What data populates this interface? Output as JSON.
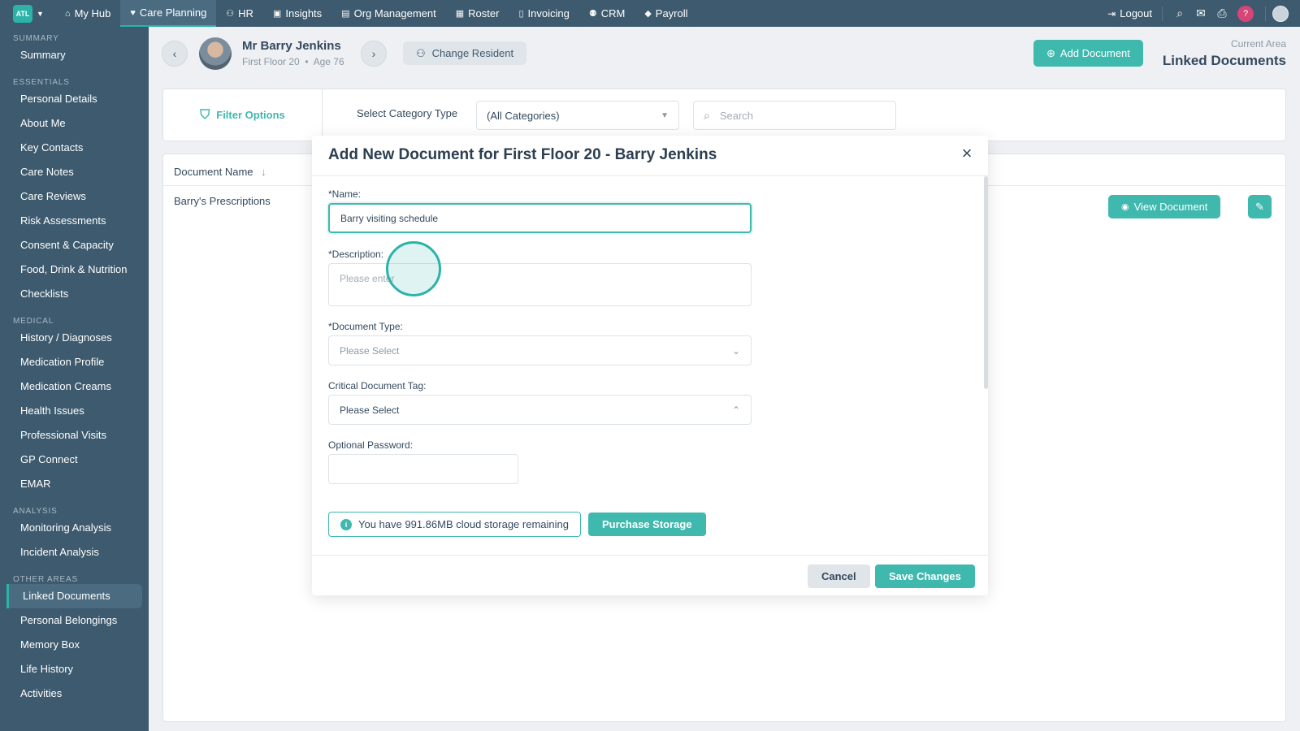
{
  "brand": {
    "logo_text": "ATL",
    "logo_color": "#2bb3a8"
  },
  "topnav": {
    "items": [
      {
        "label": "My Hub",
        "icon": "home-icon"
      },
      {
        "label": "Care Planning",
        "icon": "heart-icon"
      },
      {
        "label": "HR",
        "icon": "people-icon"
      },
      {
        "label": "Insights",
        "icon": "chart-icon"
      },
      {
        "label": "Org Management",
        "icon": "building-icon"
      },
      {
        "label": "Roster",
        "icon": "calendar-icon"
      },
      {
        "label": "Invoicing",
        "icon": "invoice-icon"
      },
      {
        "label": "CRM",
        "icon": "contacts-icon"
      },
      {
        "label": "Payroll",
        "icon": "payroll-icon"
      }
    ],
    "active": "Care Planning",
    "logout_label": "Logout",
    "help_label": "?"
  },
  "sidebar": {
    "sections": [
      {
        "title": "Summary",
        "items": [
          "Summary"
        ]
      },
      {
        "title": "Essentials",
        "items": [
          "Personal Details",
          "About Me",
          "Key Contacts",
          "Care Notes",
          "Care Reviews",
          "Risk Assessments",
          "Consent & Capacity",
          "Food, Drink & Nutrition",
          "Checklists"
        ]
      },
      {
        "title": "Medical",
        "items": [
          "History / Diagnoses",
          "Medication Profile",
          "Medication Creams",
          "Health Issues",
          "Professional Visits",
          "GP Connect",
          "EMAR"
        ]
      },
      {
        "title": "Analysis",
        "items": [
          "Monitoring Analysis",
          "Incident Analysis"
        ]
      },
      {
        "title": "Other Areas",
        "items": [
          "Linked Documents",
          "Personal Belongings",
          "Memory Box",
          "Life History",
          "Activities"
        ]
      }
    ],
    "active": "Linked Documents"
  },
  "header": {
    "resident_name": "Mr Barry Jenkins",
    "resident_location": "First Floor 20",
    "resident_age": "Age 76",
    "change_resident_label": "Change Resident",
    "add_document_label": "Add Document",
    "current_area_label": "Current Area",
    "current_area": "Linked Documents"
  },
  "filter": {
    "options_label": "Filter Options",
    "category_label": "Select Category Type",
    "category_value": "(All Categories)",
    "search_placeholder": "Search"
  },
  "table": {
    "column_header": "Document Name",
    "rows": [
      {
        "name": "Barry's Prescriptions",
        "view_label": "View Document"
      }
    ]
  },
  "modal": {
    "title": "Add New Document for First Floor 20 - Barry Jenkins",
    "name_label": "*Name:",
    "name_value": "Barry visiting schedule",
    "description_label": "*Description:",
    "description_placeholder": "Please enter",
    "doc_type_label": "*Document Type:",
    "doc_type_value": "Please Select",
    "critical_tag_label": "Critical Document Tag:",
    "critical_tag_value": "Please Select",
    "password_label": "Optional Password:",
    "password_value": "",
    "storage_text": "You have 991.86MB cloud storage remaining",
    "purchase_label": "Purchase Storage",
    "cancel_label": "Cancel",
    "save_label": "Save Changes"
  },
  "colors": {
    "nav_bg": "#3d5a6e",
    "accent": "#3fb8ae",
    "help": "#d64577"
  }
}
